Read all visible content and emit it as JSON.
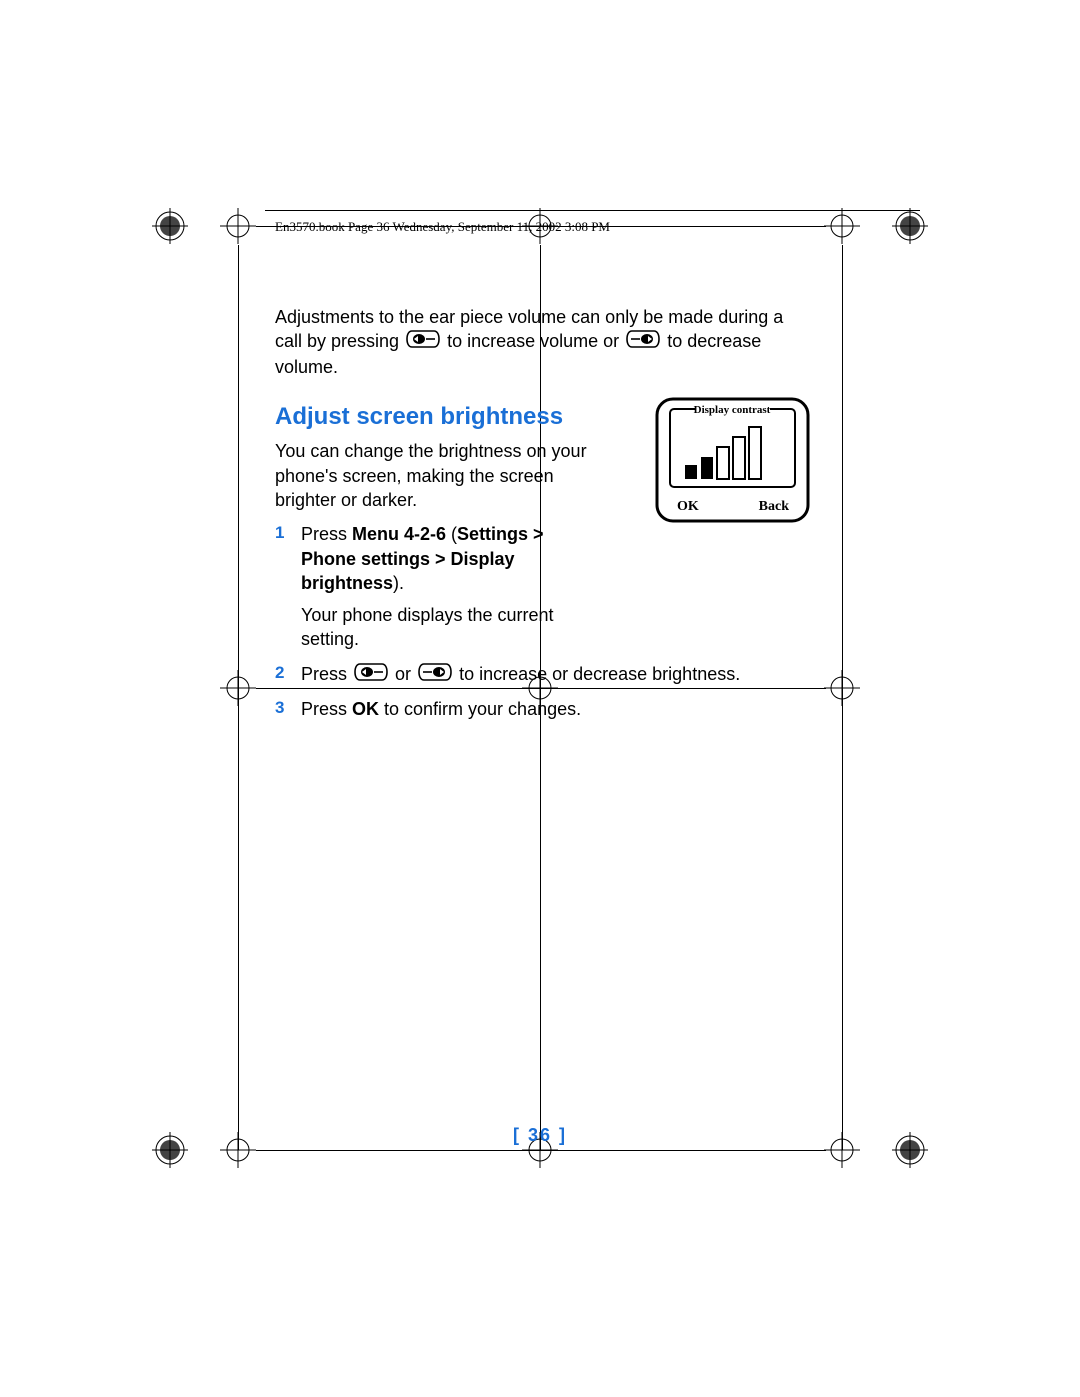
{
  "header": {
    "stamp": "En3570.book  Page 36  Wednesday, September 11, 2002  3:08 PM"
  },
  "body": {
    "par1a": "Adjustments to the ear piece volume can only be made during a call by pressing ",
    "par1b": " to increase volume or ",
    "par1c": " to decrease volume.",
    "heading": "Adjust screen brightness",
    "intro": "You can change the brightness on your phone's screen, making the screen brighter or darker."
  },
  "phone": {
    "title": "Display contrast",
    "ok": "OK",
    "back": "Back"
  },
  "steps": {
    "s1": {
      "num": "1",
      "a": "Press ",
      "b": "Menu 4-2-6",
      "c": " (",
      "d": "Settings > Phone settings > Display brightness",
      "e": ").",
      "after": "Your phone displays the current setting."
    },
    "s2": {
      "num": "2",
      "a": "Press ",
      "b": " or ",
      "c": " to increase or decrease brightness."
    },
    "s3": {
      "num": "3",
      "a": "Press ",
      "b": "OK",
      "c": " to confirm your changes."
    }
  },
  "footer": {
    "page": "[ 36 ]"
  }
}
